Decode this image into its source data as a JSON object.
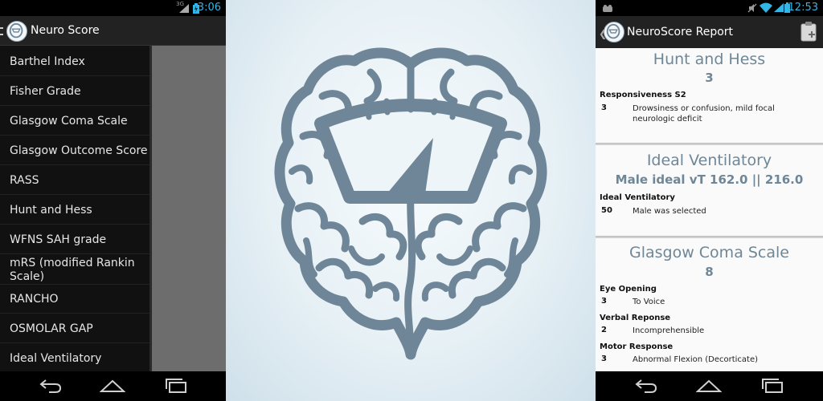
{
  "left_phone": {
    "status_time": "3:06",
    "network_label": "3G",
    "app_title": "Neuro Score",
    "menu_items": [
      "Barthel Index",
      "Fisher Grade",
      "Glasgow Coma Scale",
      "Glasgow Outcome Score",
      "RASS",
      "Hunt and Hess",
      "WFNS SAH grade",
      "mRS  (modified Rankin Scale)",
      "RANCHO",
      "OSMOLAR GAP",
      "Ideal Ventilatory"
    ]
  },
  "right_phone": {
    "status_time": "12:53",
    "title": "NeuroScore Report",
    "cards": [
      {
        "title": "Hunt and Hess",
        "score": "3",
        "sections": [
          {
            "label": "Responsiveness S2",
            "rows": [
              {
                "score": "3",
                "text": "Drowsiness or confusion, mild focal neurologic deficit"
              }
            ]
          }
        ]
      },
      {
        "title": "Ideal Ventilatory",
        "score": "Male ideal vT 162.0  ||  216.0",
        "sections": [
          {
            "label": "Ideal Ventilatory",
            "rows": [
              {
                "score": "50",
                "text": "Male was selected"
              }
            ]
          }
        ]
      },
      {
        "title": "Glasgow Coma Scale",
        "score": "8",
        "sections": [
          {
            "label": "Eye Opening",
            "rows": [
              {
                "score": "3",
                "text": "To Voice"
              }
            ]
          },
          {
            "label": "Verbal Reponse",
            "rows": [
              {
                "score": "2",
                "text": "Incomprehensible"
              }
            ]
          },
          {
            "label": "Motor Response",
            "rows": [
              {
                "score": "3",
                "text": "Abnormal Flexion (Decorticate)"
              }
            ]
          }
        ]
      }
    ]
  },
  "icons": [
    "drawer-caret-icon",
    "app-logo-icon",
    "signal-icon",
    "battery-icon",
    "wifi-icon",
    "mute-icon",
    "clipboard-icon",
    "back-icon",
    "home-icon",
    "recent-apps-icon",
    "brain-gauge-logo-icon"
  ],
  "colors": {
    "accent": "#33b5e5",
    "report_heading": "#6f8697",
    "brain_blue": "#6e8698",
    "actionbar": "#222222"
  }
}
